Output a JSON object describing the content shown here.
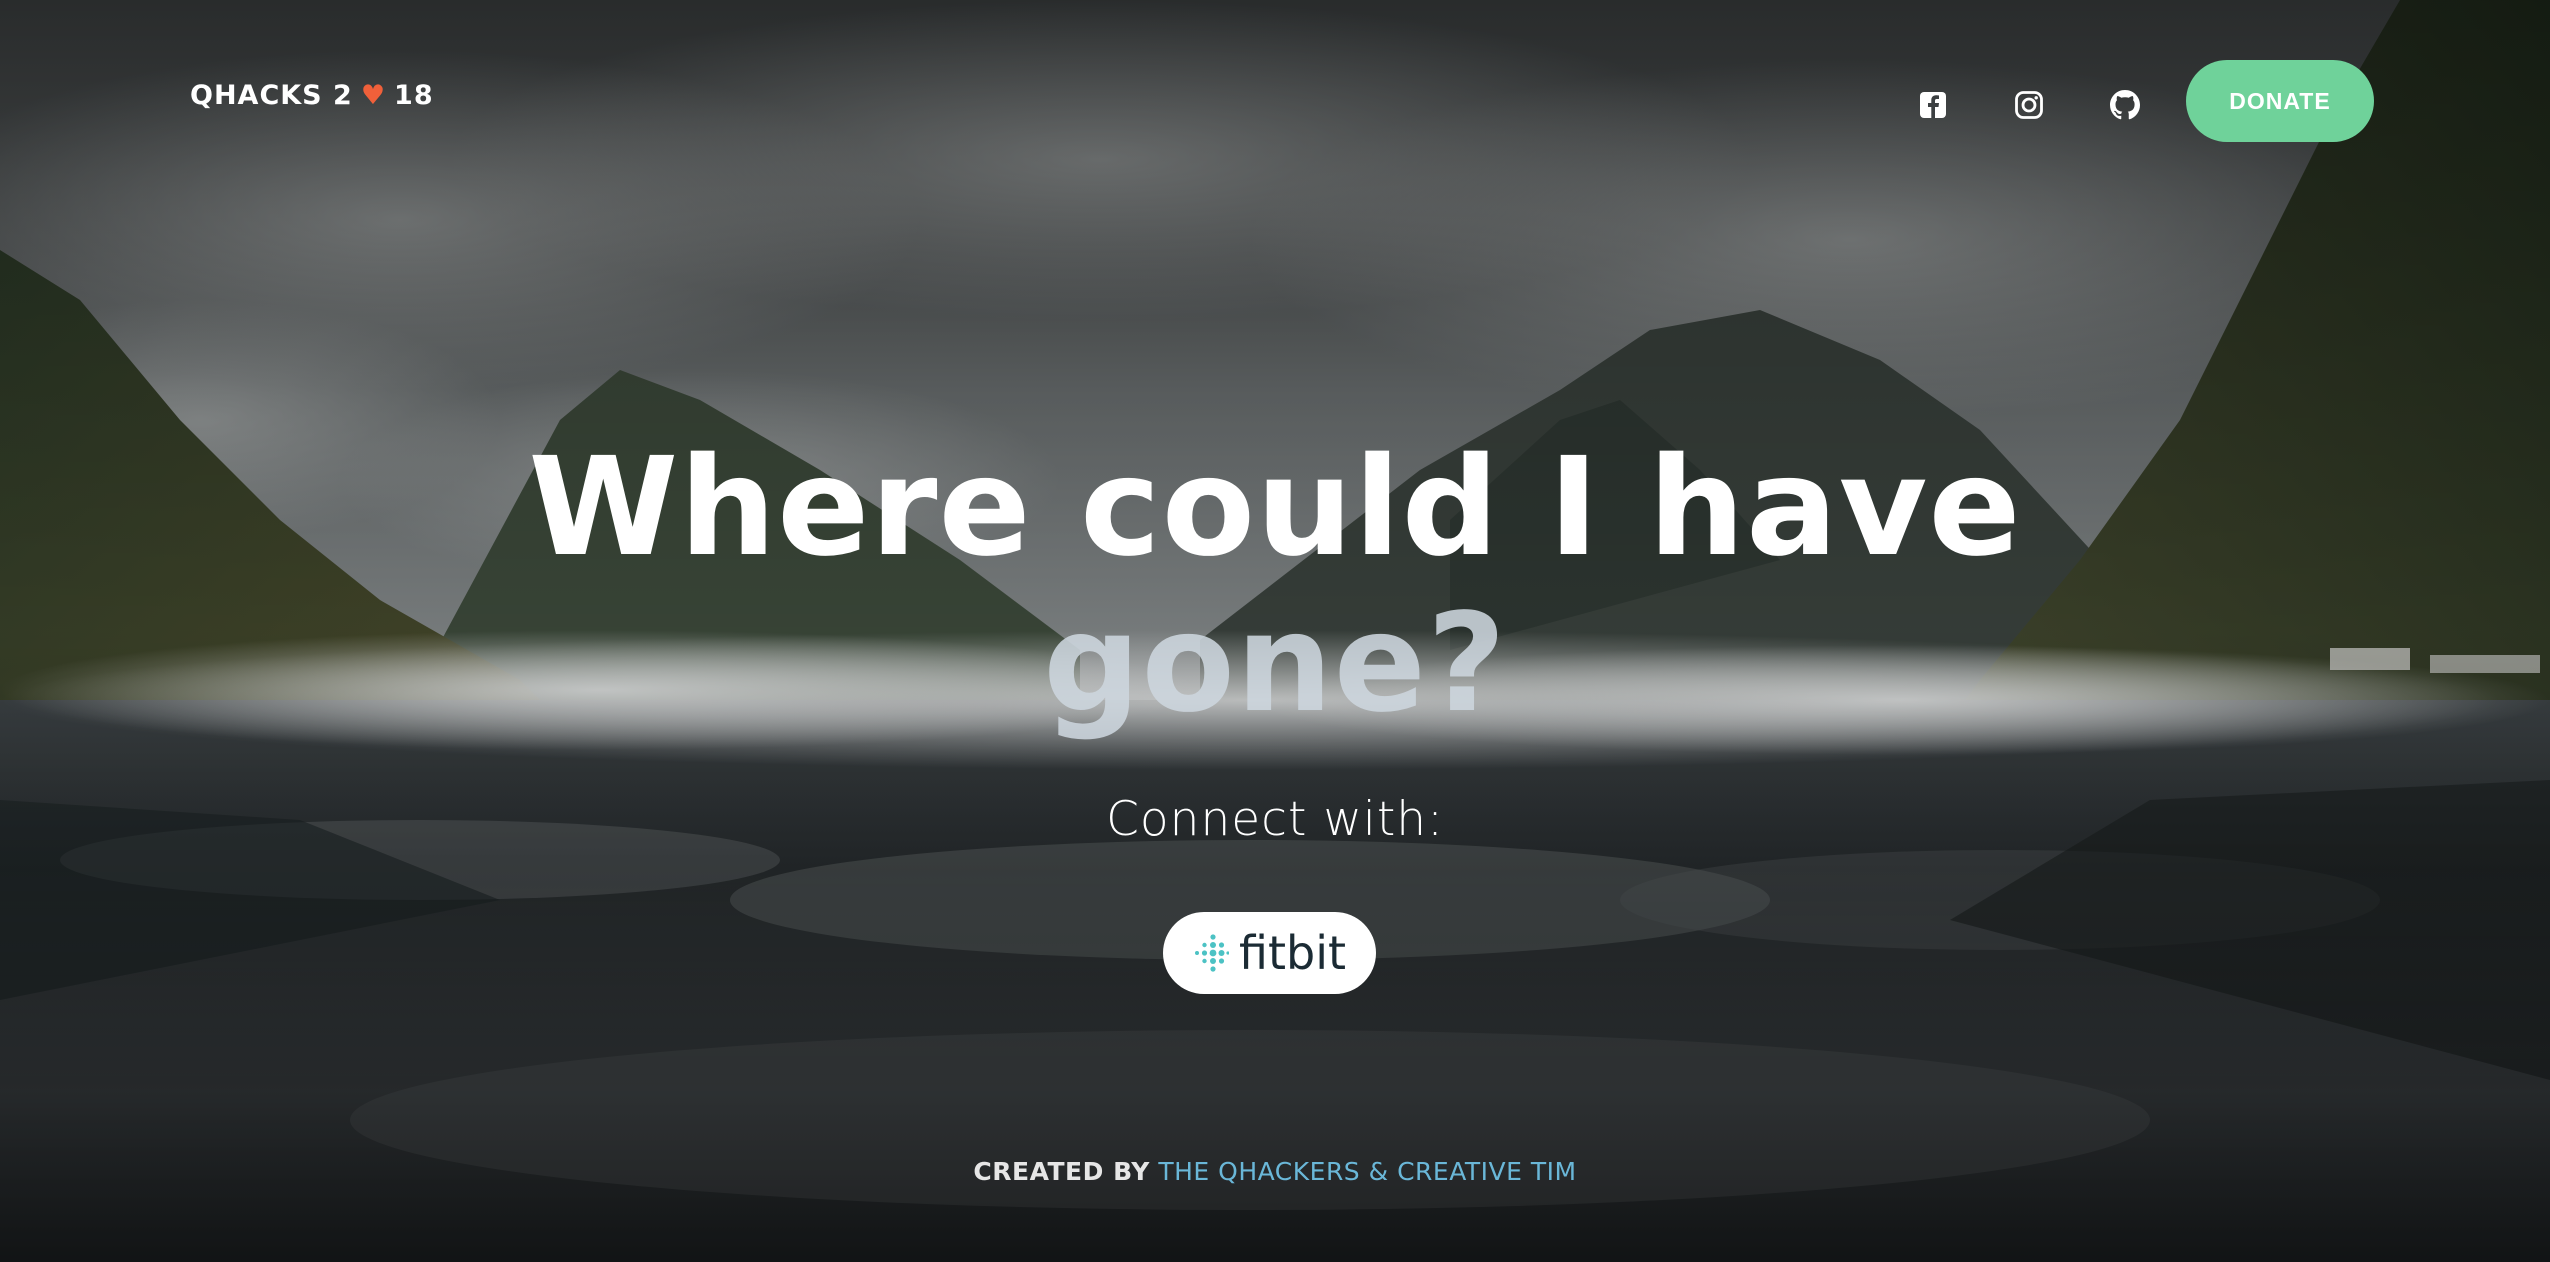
{
  "navbar": {
    "brand": {
      "prefix": "QHACKS 2",
      "heart": "♥",
      "suffix": "18"
    },
    "icons": [
      "facebook-icon",
      "instagram-icon",
      "github-icon"
    ],
    "donate_label": "DONATE"
  },
  "hero": {
    "title_line1": "Where could I have",
    "title_line2": "gone?",
    "connect_label": "Connect with:",
    "fitbit_label": "fitbit"
  },
  "footer": {
    "created_by": "CREATED BY",
    "credit_link": "THE QHACKERS & CREATIVE TIM"
  },
  "colors": {
    "donate": "#6fd29a",
    "heart": "#f0603a",
    "link": "#6ab7d8",
    "fitbit_teal": "#4cc2c4"
  }
}
